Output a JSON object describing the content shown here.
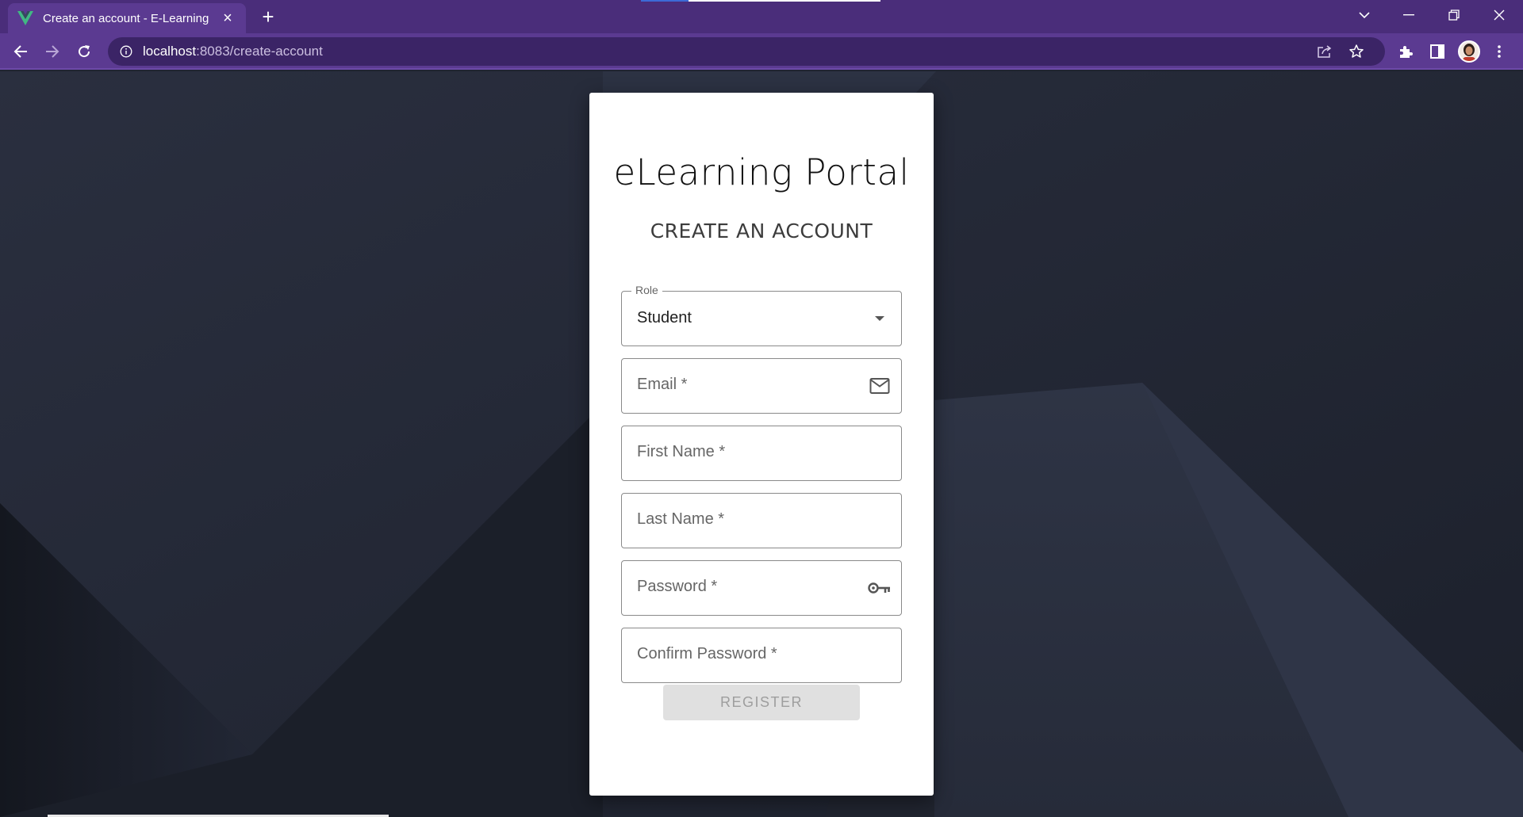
{
  "browser": {
    "tab_title": "Create an account - E-Learning",
    "new_tab_label": "+",
    "close_tab_label": "×",
    "url_host": "localhost",
    "url_port_path": ":8083/create-account"
  },
  "page": {
    "brand_title": "eLearning Portal",
    "subtitle": "CREATE AN ACCOUNT",
    "form": {
      "role": {
        "legend": "Role",
        "value": "Student",
        "icon": "dropdown-arrow-icon"
      },
      "email": {
        "label": "Email *",
        "value": "",
        "icon": "mail-icon"
      },
      "first_name": {
        "label": "First Name *",
        "value": ""
      },
      "last_name": {
        "label": "Last Name *",
        "value": ""
      },
      "password": {
        "label": "Password *",
        "value": "",
        "icon": "key-icon"
      },
      "confirm_password": {
        "label": "Confirm Password *",
        "value": ""
      }
    },
    "register_label": "REGISTER"
  },
  "colors": {
    "chrome_titlebar": "#4a2d7a",
    "chrome_toolbar": "#5b3a91",
    "page_background": "#252a39",
    "card_background": "#ffffff",
    "button_disabled": "#e0e0e0"
  }
}
